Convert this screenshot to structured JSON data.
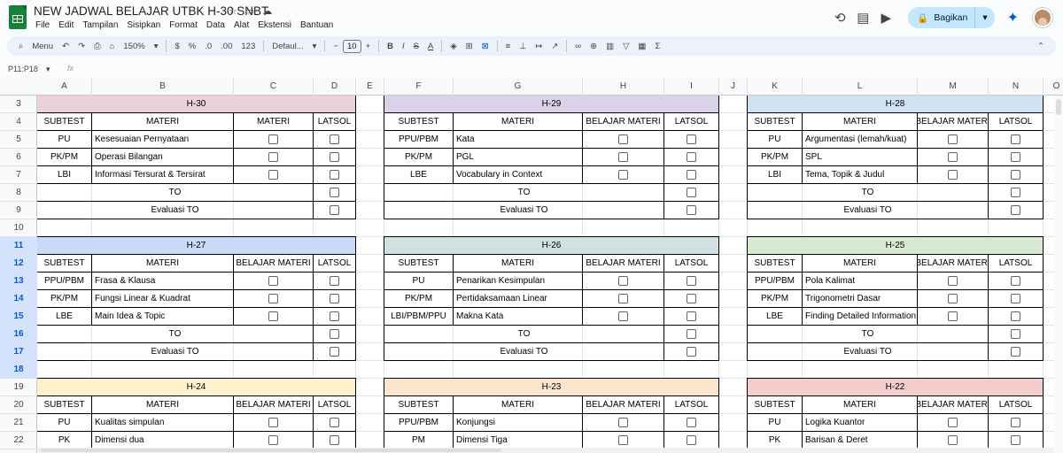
{
  "app": {
    "title": "NEW JADWAL BELAJAR UTBK H-30 SNBT",
    "menus": [
      "File",
      "Edit",
      "Tampilan",
      "Sisipkan",
      "Format",
      "Data",
      "Alat",
      "Ekstensi",
      "Bantuan"
    ],
    "share_label": "Bagikan"
  },
  "toolbar": {
    "menu_label": "Menu",
    "zoom": "150%",
    "currency": "$",
    "percent": "%",
    "dec_less": ".0",
    "dec_more": ".00",
    "format_123": "123",
    "font": "Defaul...",
    "font_size": "10"
  },
  "formula_bar": {
    "name_box": "P11:P18",
    "fx": "fx"
  },
  "columns": [
    "A",
    "B",
    "C",
    "D",
    "E",
    "F",
    "G",
    "H",
    "I",
    "J",
    "K",
    "L",
    "M",
    "N",
    "O"
  ],
  "rows": [
    "3",
    "4",
    "5",
    "6",
    "7",
    "8",
    "9",
    "10",
    "11",
    "12",
    "13",
    "14",
    "15",
    "16",
    "17",
    "18",
    "19",
    "20",
    "21",
    "22"
  ],
  "selected_rows": [
    "11",
    "12",
    "13",
    "14",
    "15",
    "16",
    "17",
    "18"
  ],
  "colors": {
    "h30": "#ead1dc",
    "h29": "#d9d2e9",
    "h28": "#cfe2f3",
    "h27": "#c9daf8",
    "h26": "#d0e0e3",
    "h25": "#d9ead3",
    "h24": "#fff2cc",
    "h23": "#fce5cd",
    "h22": "#f4cccc",
    "accent": "#0b57d0",
    "share_bg": "#c2e7ff"
  },
  "blocks": [
    {
      "id": "h30",
      "title": "H-30",
      "headers": [
        "SUBTEST",
        "MATERI",
        "MATERI",
        "LATSOL"
      ],
      "items": [
        [
          "PU",
          "Kesesuaian Pernyataan"
        ],
        [
          "PK/PM",
          "Operasi Bilangan"
        ],
        [
          "LBI",
          "Informasi Tersurat & Tersirat"
        ]
      ],
      "to": "TO",
      "eval": "Evaluasi TO"
    },
    {
      "id": "h29",
      "title": "H-29",
      "headers": [
        "SUBTEST",
        "MATERI",
        "BELAJAR MATERI",
        "LATSOL"
      ],
      "items": [
        [
          "PPU/PBM",
          "Kata"
        ],
        [
          "PK/PM",
          "PGL"
        ],
        [
          "LBE",
          "Vocabulary in Context"
        ]
      ],
      "to": "TO",
      "eval": "Evaluasi TO"
    },
    {
      "id": "h28",
      "title": "H-28",
      "headers": [
        "SUBTEST",
        "MATERI",
        "BELAJAR MATERI",
        "LATSOL"
      ],
      "items": [
        [
          "PU",
          "Argumentasi (lemah/kuat)"
        ],
        [
          "PK/PM",
          "SPL"
        ],
        [
          "LBI",
          "Tema, Topik & Judul"
        ]
      ],
      "to": "TO",
      "eval": "Evaluasi TO"
    },
    {
      "id": "h27",
      "title": "H-27",
      "headers": [
        "SUBTEST",
        "MATERI",
        "BELAJAR MATERI",
        "LATSOL"
      ],
      "items": [
        [
          "PPU/PBM",
          "Frasa & Klausa"
        ],
        [
          "PK/PM",
          "Fungsi Linear & Kuadrat"
        ],
        [
          "LBE",
          "Main Idea & Topic"
        ]
      ],
      "to": "TO",
      "eval": "Evaluasi TO"
    },
    {
      "id": "h26",
      "title": "H-26",
      "headers": [
        "SUBTEST",
        "MATERI",
        "BELAJAR MATERI",
        "LATSOL"
      ],
      "items": [
        [
          "PU",
          "Penarikan Kesimpulan"
        ],
        [
          "PK/PM",
          "Pertidaksamaan Linear"
        ],
        [
          "LBI/PBM/PPU",
          "Makna Kata"
        ]
      ],
      "to": "TO",
      "eval": "Evaluasi TO"
    },
    {
      "id": "h25",
      "title": "H-25",
      "headers": [
        "SUBTEST",
        "MATERI",
        "BELAJAR MATERI",
        "LATSOL"
      ],
      "items": [
        [
          "PPU/PBM",
          "Pola Kalimat"
        ],
        [
          "PK/PM",
          "Trigonometri Dasar"
        ],
        [
          "LBE",
          "Finding Detailed Information"
        ]
      ],
      "to": "TO",
      "eval": "Evaluasi TO"
    },
    {
      "id": "h24",
      "title": "H-24",
      "headers": [
        "SUBTEST",
        "MATERI",
        "BELAJAR MATERI",
        "LATSOL"
      ],
      "items": [
        [
          "PU",
          "Kualitas simpulan"
        ],
        [
          "PK",
          "Dimensi dua"
        ]
      ],
      "to": "",
      "eval": ""
    },
    {
      "id": "h23",
      "title": "H-23",
      "headers": [
        "SUBTEST",
        "MATERI",
        "BELAJAR MATERI",
        "LATSOL"
      ],
      "items": [
        [
          "PPU/PBM",
          "Konjungsi"
        ],
        [
          "PM",
          "Dimensi Tiga"
        ]
      ],
      "to": "",
      "eval": ""
    },
    {
      "id": "h22",
      "title": "H-22",
      "headers": [
        "SUBTEST",
        "MATERI",
        "BELAJAR MATERI",
        "LATSOL"
      ],
      "items": [
        [
          "PU",
          "Logika Kuantor"
        ],
        [
          "PK",
          "Barisan & Deret"
        ]
      ],
      "to": "",
      "eval": ""
    }
  ]
}
